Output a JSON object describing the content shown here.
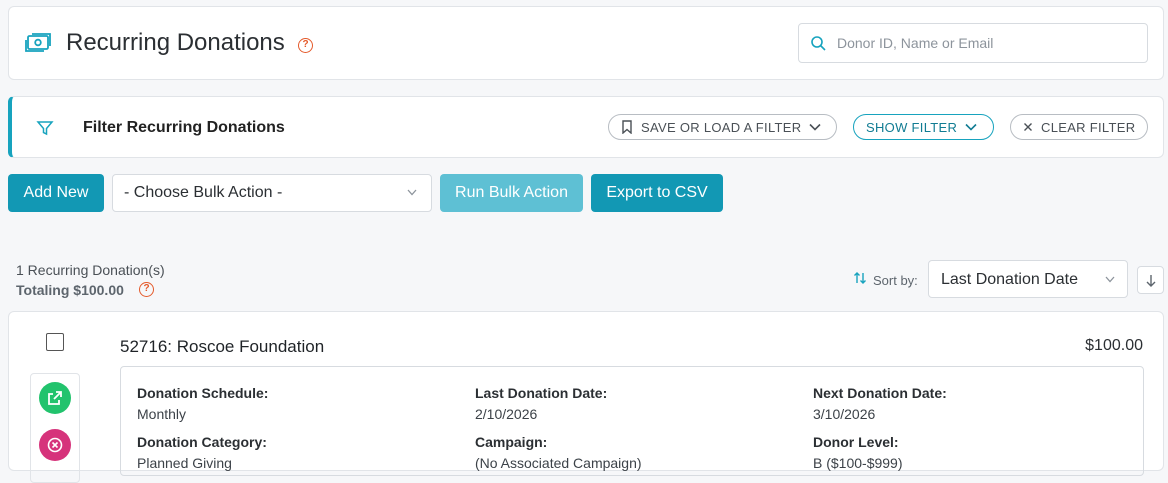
{
  "header": {
    "title": "Recurring Donations",
    "help_glyph": "?",
    "search_placeholder": "Donor ID, Name or Email",
    "icons": {
      "title": "money-icon",
      "search": "search-icon"
    }
  },
  "filter": {
    "title": "Filter Recurring Donations",
    "save_load_label": "SAVE OR LOAD A FILTER",
    "show_filter_label": "SHOW FILTER",
    "clear_filter_label": "CLEAR FILTER"
  },
  "actions": {
    "add_new": "Add New",
    "bulk_action_selected": "- Choose Bulk Action -",
    "run_bulk_action": "Run Bulk Action",
    "export_csv": "Export to CSV"
  },
  "summary": {
    "count_text": "1 Recurring Donation(s)",
    "total_text": "Totaling $100.00",
    "help_glyph": "?"
  },
  "sort": {
    "label": "Sort by:",
    "selected": "Last Donation Date"
  },
  "donation": {
    "name": "52716: Roscoe Foundation",
    "amount": "$100.00",
    "fields": [
      {
        "label": "Donation Schedule:",
        "value": "Monthly"
      },
      {
        "label": "Last Donation Date:",
        "value": "2/10/2026"
      },
      {
        "label": "Next Donation Date:",
        "value": "3/10/2026"
      },
      {
        "label": "Donation Category:",
        "value": "Planned Giving"
      },
      {
        "label": "Campaign:",
        "value": "(No Associated Campaign)"
      },
      {
        "label": "Donor Level:",
        "value": "B ($100-$999)"
      }
    ]
  },
  "colors": {
    "accent": "#1298b4",
    "accent_light": "#5ec0d4",
    "help": "#e45a2b",
    "edit": "#22c36d",
    "cancel": "#d6337b"
  }
}
